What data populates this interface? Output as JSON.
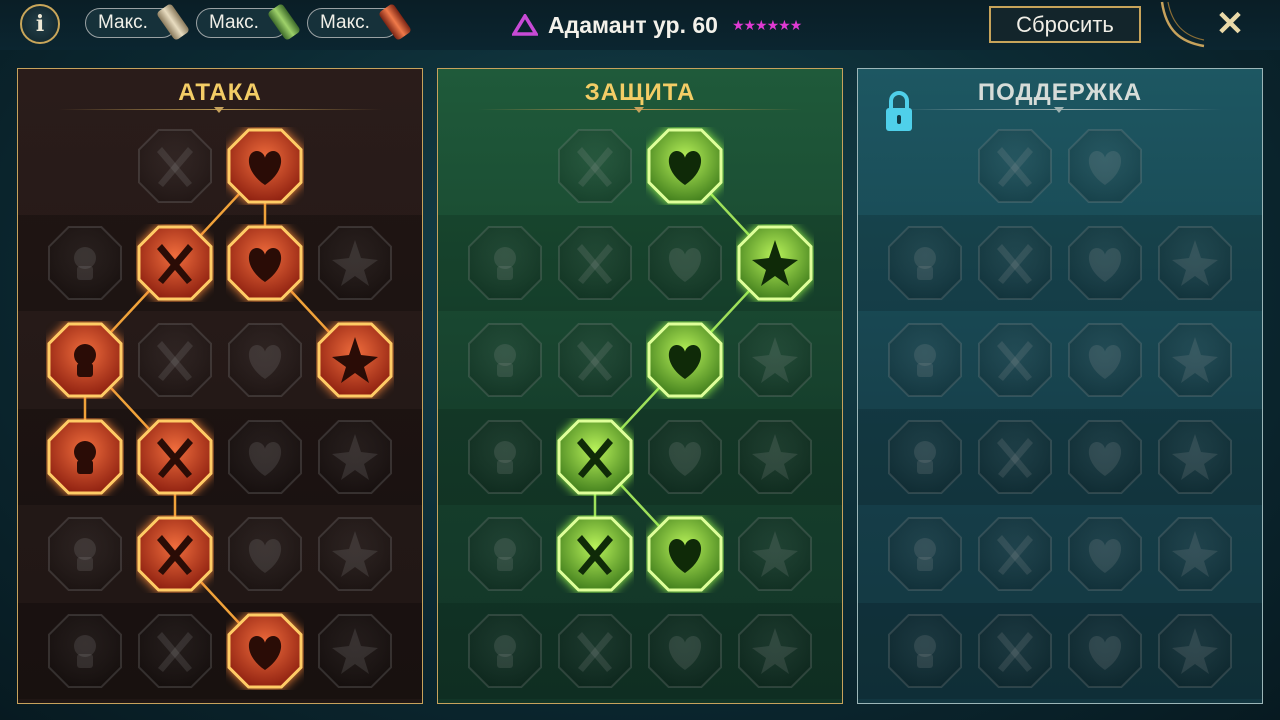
{
  "topbar": {
    "info_label": "i",
    "max_buttons": [
      {
        "label": "Макс.",
        "scroll_color": "#c9b796"
      },
      {
        "label": "Макс.",
        "scroll_color": "#6fa04c"
      },
      {
        "label": "Макс.",
        "scroll_color": "#c8482c"
      }
    ],
    "title": "Адамант ур. 60",
    "stars": "★★★★★★",
    "reset_label": "Сбросить",
    "close_label": "✕"
  },
  "colors": {
    "gold": "#c7a25c",
    "attack_active": "#e2502a",
    "defense_active": "#7fe03a",
    "star_color": "#e03ad3"
  },
  "panels": [
    {
      "id": "attack",
      "title": "АТАКА",
      "locked": false,
      "nodes": [
        {
          "row": 0,
          "col": 1,
          "icon": "crossed-swords-icon",
          "active": false
        },
        {
          "row": 0,
          "col": 2,
          "icon": "slashing-dagger-icon",
          "active": true
        },
        {
          "row": 1,
          "col": 0,
          "icon": "demon-bust-icon",
          "active": false
        },
        {
          "row": 1,
          "col": 1,
          "icon": "flaming-sword-icon",
          "active": true
        },
        {
          "row": 1,
          "col": 2,
          "icon": "broken-shield-icon",
          "active": true
        },
        {
          "row": 1,
          "col": 3,
          "icon": "cracked-heart-icon",
          "active": false
        },
        {
          "row": 2,
          "col": 0,
          "icon": "arrow-pierced-body-icon",
          "active": true
        },
        {
          "row": 2,
          "col": 1,
          "icon": "fanged-mouth-icon",
          "active": false
        },
        {
          "row": 2,
          "col": 2,
          "icon": "hooded-skull-icon",
          "active": false
        },
        {
          "row": 2,
          "col": 3,
          "icon": "scythe-hand-icon",
          "active": true
        },
        {
          "row": 3,
          "col": 0,
          "icon": "bleeding-heart-icon",
          "active": true
        },
        {
          "row": 3,
          "col": 1,
          "icon": "fist-sword-icon",
          "active": true
        },
        {
          "row": 3,
          "col": 2,
          "icon": "axe-icon",
          "active": false
        },
        {
          "row": 3,
          "col": 3,
          "icon": "lightning-chain-icon",
          "active": false
        },
        {
          "row": 4,
          "col": 0,
          "icon": "claw-slash-icon",
          "active": false
        },
        {
          "row": 4,
          "col": 1,
          "icon": "triple-skull-icon",
          "active": true
        },
        {
          "row": 4,
          "col": 2,
          "icon": "sword-arc-icon",
          "active": false
        },
        {
          "row": 4,
          "col": 3,
          "icon": "flexing-figure-icon",
          "active": false
        },
        {
          "row": 5,
          "col": 0,
          "icon": "broken-sword-icon",
          "active": false
        },
        {
          "row": 5,
          "col": 1,
          "icon": "knight-helmet-icon",
          "active": false
        },
        {
          "row": 5,
          "col": 2,
          "icon": "horned-demon-icon",
          "active": true
        },
        {
          "row": 5,
          "col": 3,
          "icon": "skull-flames-icon",
          "active": false
        }
      ],
      "links": [
        [
          0,
          2,
          1,
          2
        ],
        [
          0,
          2,
          1,
          1
        ],
        [
          1,
          1,
          2,
          0
        ],
        [
          1,
          2,
          2,
          3
        ],
        [
          2,
          0,
          3,
          0
        ],
        [
          2,
          0,
          3,
          1
        ],
        [
          3,
          1,
          4,
          1
        ],
        [
          4,
          1,
          5,
          2
        ]
      ]
    },
    {
      "id": "defense",
      "title": "ЗАЩИТА",
      "locked": false,
      "nodes": [
        {
          "row": 0,
          "col": 1,
          "icon": "armor-plate-icon",
          "active": false
        },
        {
          "row": 0,
          "col": 2,
          "icon": "raised-fist-icon",
          "active": true
        },
        {
          "row": 1,
          "col": 0,
          "icon": "chest-armor-icon",
          "active": false
        },
        {
          "row": 1,
          "col": 1,
          "icon": "heart-anatomy-icon",
          "active": false
        },
        {
          "row": 1,
          "col": 2,
          "icon": "brute-figure-icon",
          "active": false
        },
        {
          "row": 1,
          "col": 3,
          "icon": "crossed-blades-icon",
          "active": true
        },
        {
          "row": 2,
          "col": 0,
          "icon": "defending-figure-icon",
          "active": false
        },
        {
          "row": 2,
          "col": 1,
          "icon": "shield-guard-icon",
          "active": false
        },
        {
          "row": 2,
          "col": 2,
          "icon": "skull-heart-icon",
          "active": true
        },
        {
          "row": 2,
          "col": 3,
          "icon": "bald-head-icon",
          "active": false
        },
        {
          "row": 3,
          "col": 0,
          "icon": "two-figures-icon",
          "active": false
        },
        {
          "row": 3,
          "col": 1,
          "icon": "hourglass-skull-icon",
          "active": true
        },
        {
          "row": 3,
          "col": 2,
          "icon": "open-hand-icon",
          "active": false
        },
        {
          "row": 3,
          "col": 3,
          "icon": "bull-head-icon",
          "active": false
        },
        {
          "row": 4,
          "col": 0,
          "icon": "running-figure-icon",
          "active": false
        },
        {
          "row": 4,
          "col": 1,
          "icon": "poison-drops-icon",
          "active": true
        },
        {
          "row": 4,
          "col": 2,
          "icon": "radiant-skull-icon",
          "active": true
        },
        {
          "row": 4,
          "col": 3,
          "icon": "swirl-icon",
          "active": false
        },
        {
          "row": 5,
          "col": 0,
          "icon": "hands-up-icon",
          "active": false
        },
        {
          "row": 5,
          "col": 1,
          "icon": "shield-arrow-icon",
          "active": false
        },
        {
          "row": 5,
          "col": 2,
          "icon": "muscle-figure-icon",
          "active": false
        },
        {
          "row": 5,
          "col": 3,
          "icon": "strongman-icon",
          "active": false
        }
      ],
      "links": [
        [
          0,
          2,
          1,
          3
        ],
        [
          1,
          3,
          2,
          2
        ],
        [
          2,
          2,
          3,
          1
        ],
        [
          3,
          1,
          4,
          1
        ],
        [
          3,
          1,
          4,
          2
        ]
      ]
    },
    {
      "id": "support",
      "title": "ПОДДЕРЖКА",
      "locked": true,
      "nodes": [
        {
          "row": 0,
          "col": 1,
          "icon": "heart-plus-icon",
          "active": false
        },
        {
          "row": 0,
          "col": 2,
          "icon": "swirl-eye-icon",
          "active": false
        },
        {
          "row": 1,
          "col": 0,
          "icon": "praying-hands-icon",
          "active": false
        },
        {
          "row": 1,
          "col": 1,
          "icon": "round-shield-icon",
          "active": false
        },
        {
          "row": 1,
          "col": 2,
          "icon": "smoke-skull-icon",
          "active": false
        },
        {
          "row": 1,
          "col": 3,
          "icon": "speed-lines-icon",
          "active": false
        },
        {
          "row": 2,
          "col": 0,
          "icon": "blessed-figure-icon",
          "active": false
        },
        {
          "row": 2,
          "col": 1,
          "icon": "lightning-icon",
          "active": false
        },
        {
          "row": 2,
          "col": 2,
          "icon": "cracked-ground-icon",
          "active": false
        },
        {
          "row": 2,
          "col": 3,
          "icon": "twin-figures-icon",
          "active": false
        },
        {
          "row": 3,
          "col": 0,
          "icon": "chained-heart-icon",
          "active": false
        },
        {
          "row": 3,
          "col": 1,
          "icon": "meteor-icon",
          "active": false
        },
        {
          "row": 3,
          "col": 2,
          "icon": "open-book-icon",
          "active": false
        },
        {
          "row": 3,
          "col": 3,
          "icon": "rage-face-icon",
          "active": false
        },
        {
          "row": 4,
          "col": 0,
          "icon": "compass-star-icon",
          "active": false
        },
        {
          "row": 4,
          "col": 1,
          "icon": "winged-boot-icon",
          "active": false
        },
        {
          "row": 4,
          "col": 2,
          "icon": "eye-icon",
          "active": false
        },
        {
          "row": 4,
          "col": 3,
          "icon": "pierced-figure-icon",
          "active": false
        },
        {
          "row": 5,
          "col": 0,
          "icon": "potion-icon",
          "active": false
        },
        {
          "row": 5,
          "col": 1,
          "icon": "winged-skull-icon",
          "active": false
        },
        {
          "row": 5,
          "col": 2,
          "icon": "fist-crush-icon",
          "active": false
        },
        {
          "row": 5,
          "col": 3,
          "icon": "eagle-head-icon",
          "active": false
        }
      ],
      "links": []
    }
  ]
}
